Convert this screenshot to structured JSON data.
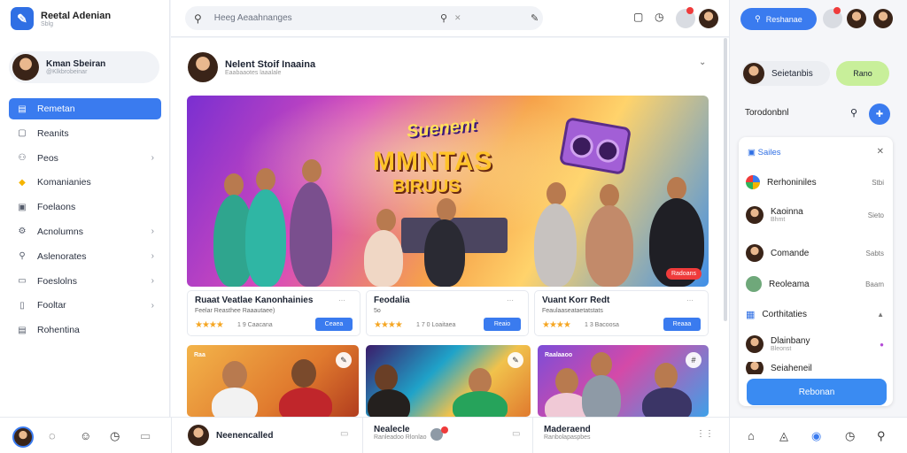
{
  "app": {
    "title": "Reetal Adenian",
    "subtitle": "Sblg",
    "logo_icon": "feather-icon"
  },
  "profile": {
    "name": "Kman Sbeiran",
    "sub": "@Klkbrobeinar"
  },
  "sidebar": {
    "items": [
      {
        "label": "Remetan",
        "icon": "home-icon",
        "active": true,
        "chevron": false
      },
      {
        "label": "Reanits",
        "icon": "list-icon",
        "active": false,
        "chevron": false
      },
      {
        "label": "Peos",
        "icon": "user-icon",
        "active": false,
        "chevron": true
      },
      {
        "label": "Komanianies",
        "icon": "folder-icon",
        "active": false,
        "chevron": false
      },
      {
        "label": "Foelaons",
        "icon": "calendar-icon",
        "active": false,
        "chevron": false
      },
      {
        "label": "Acnolumns",
        "icon": "settings-icon",
        "active": false,
        "chevron": true
      },
      {
        "label": "Aslenorates",
        "icon": "analytics-icon",
        "active": false,
        "chevron": true
      },
      {
        "label": "Foeslolns",
        "icon": "bookmark-icon",
        "active": false,
        "chevron": true
      },
      {
        "label": "Fooltar",
        "icon": "document-icon",
        "active": false,
        "chevron": true
      },
      {
        "label": "Rohentina",
        "icon": "archive-icon",
        "active": false,
        "chevron": false
      }
    ]
  },
  "topbar": {
    "search_placeholder": "Heeg Aeaahnanges"
  },
  "post": {
    "author": "Nelent Stoif Inaaina",
    "sub": "Eaabaaotes laaalale",
    "hero": {
      "title1": "Suenent",
      "title2": "MMNTAS",
      "title3": "BIRUUS",
      "badge": "Radoans"
    }
  },
  "cards": [
    {
      "title": "Ruaat Veatlae Kanonhainies",
      "sub": "Feelar Reasthee Raaautaee)",
      "meta": "1 9 Caacana",
      "btn": "Ceaea",
      "rating": 4
    },
    {
      "title": "Feodalia",
      "sub": "5o",
      "meta": "1 7 0 Loaitaea",
      "btn": "Reaio",
      "rating": 4
    },
    {
      "title": "Vuant Korr Redt",
      "sub": "Feaulaaseataetatstats",
      "meta": "1 3 Bacoosa",
      "btn": "Reaaa",
      "rating": 4
    }
  ],
  "thumbs": [
    {
      "tag": "Raa",
      "icon": "pen-icon"
    },
    {
      "tag": "",
      "icon": "edit-icon"
    },
    {
      "tag": "Raalaaoo",
      "icon": "hashtag-icon"
    }
  ],
  "right_panel": {
    "top_button": "Reshanae",
    "user_name": "Seietanbis",
    "green_button": "Rano",
    "heading": "Torodonbnl",
    "card_head": "Sailes",
    "rows": [
      {
        "name": "Rerhoniniles",
        "sub": "",
        "right": "Stbi"
      },
      {
        "name": "Kaoinna",
        "sub": "Bhmt",
        "right": "Sieto"
      },
      {
        "name": "Comande",
        "sub": "",
        "right": "Sabts"
      },
      {
        "name": "Reoleama",
        "sub": "",
        "right": "Baam"
      },
      {
        "name": "Corthitaties",
        "sub": "",
        "right": ""
      },
      {
        "name": "Dlainbany",
        "sub": "Bleonst",
        "right": ""
      },
      {
        "name": "Seiaheneil",
        "sub": "",
        "right": ""
      }
    ],
    "cta": "Rebonan"
  },
  "bottom": {
    "chats": [
      {
        "name": "Neenencalled",
        "sub": ""
      },
      {
        "name": "Nealecle",
        "sub": "Ranleadoo Rlonlao"
      },
      {
        "name": "Maderaend",
        "sub": "Ranbolapaspbes"
      }
    ]
  },
  "colors": {
    "accent": "#3a7bef",
    "green": "#c8ef9a",
    "star": "#f5a623",
    "alert": "#ef3b3b"
  }
}
